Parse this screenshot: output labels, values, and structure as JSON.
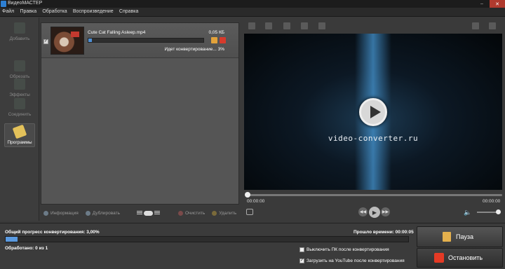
{
  "window": {
    "title": "ВидеоМАСТЕР"
  },
  "menu": [
    "Файл",
    "Правка",
    "Обработка",
    "Воспроизведение",
    "Справка"
  ],
  "tools": [
    {
      "label": "Добавить",
      "icon": "add-film-icon"
    },
    {
      "label": "Обрезать",
      "icon": "cut-icon"
    },
    {
      "label": "Эффекты",
      "icon": "effects-icon"
    },
    {
      "label": "Соединить",
      "icon": "join-icon"
    },
    {
      "label": "Программы",
      "icon": "programs-icon"
    }
  ],
  "file": {
    "name": "Cute Cat Falling Asleep.mp4",
    "size": "0,05 КБ",
    "status": "Идет конвертирование... 3%",
    "progress": 0.03
  },
  "list_toolbar": {
    "info": "Информация",
    "duplicate": "Дублировать",
    "clear": "Очистить",
    "delete": "Удалить"
  },
  "preview": {
    "watermark": "video-converter.ru",
    "time_current": "00:00:00",
    "time_total": "00:00:00"
  },
  "status": {
    "overall_label": "Общий прогресс конвертирования: 3,00%",
    "overall_progress": 0.03,
    "elapsed": "Прошло времени: 00:00:05",
    "processed": "Обработано: 0 из 1",
    "opt_shutdown": "Выключить ПК после конвертирования",
    "opt_youtube": "Загрузить на YouTube после конвертирования",
    "opt_youtube_checked": "✓"
  },
  "buttons": {
    "pause": "Пауза",
    "stop": "Остановить"
  },
  "colors": {
    "accent": "#4d8fd6",
    "stop": "#e43a25",
    "pause": "#e4b04d"
  }
}
